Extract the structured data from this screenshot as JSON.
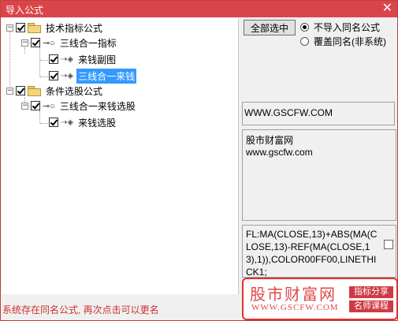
{
  "window": {
    "title": "导入公式",
    "close_glyph": "✕"
  },
  "tree": {
    "expander_glyph": "−",
    "items": [
      {
        "label": "技术指标公式",
        "checked": true,
        "icon": "folder-icon"
      },
      {
        "label": "三线合一指标",
        "checked": true,
        "icon": "key-icon"
      },
      {
        "label": "来钱副图",
        "checked": true,
        "icon": "formula-icon"
      },
      {
        "label": "三线合一来钱",
        "checked": true,
        "icon": "formula-icon",
        "selected": true
      },
      {
        "label": "条件选股公式",
        "checked": true,
        "icon": "folder-icon"
      },
      {
        "label": "三线合一来钱选股",
        "checked": true,
        "icon": "key-icon"
      },
      {
        "label": "来钱选股",
        "checked": true,
        "icon": "formula-icon"
      }
    ]
  },
  "controls": {
    "select_all_label": "全部选中",
    "radio_no_import": "不导入同名公式",
    "radio_overwrite": "覆盖同名(非系统)",
    "radio_selected": "no_import"
  },
  "info": {
    "url": "WWW.GSCFW.COM",
    "desc_line1": "股市财富网",
    "desc_line2": "www.gscfw.com",
    "code": "FL:MA(CLOSE,13)+ABS(MA(CLOSE,13)-REF(MA(CLOSE,13),1)),COLOR00FF00,LINETHICK1;"
  },
  "status": "系统存在同名公式, 再次点击可以更名",
  "watermark": {
    "title": "股市财富网",
    "url": "WWW.GSCFW.COM",
    "tag1": "指标分享",
    "tag2": "名师课程"
  },
  "colors": {
    "titlebar": "#d9454a",
    "selection": "#3399ff",
    "status_text": "#d03030",
    "watermark": "#e04848"
  }
}
